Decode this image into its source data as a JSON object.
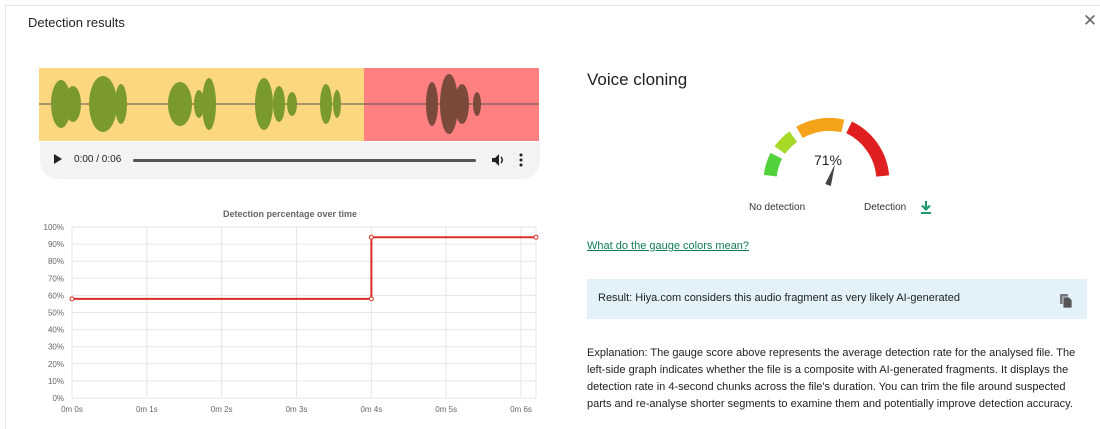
{
  "dialog": {
    "title": "Detection results",
    "close_icon": "close-icon"
  },
  "player": {
    "time": "0:00 / 0:06",
    "icons": [
      "play-icon",
      "volume-icon",
      "more-options-icon"
    ]
  },
  "waveform": {
    "colors": {
      "safe": "#fbd77f",
      "flagged": "#ff8080",
      "wave_safe": "#7a9a2f",
      "wave_flagged": "#7b4a3a"
    },
    "flagged_from_fraction": 0.65
  },
  "chart_data": {
    "type": "line",
    "title": "Detection percentage over time",
    "x": [
      0,
      4,
      4,
      6.2
    ],
    "y": [
      58,
      58,
      94,
      94
    ],
    "x_tick_labels": [
      "0m 0s",
      "0m 1s",
      "0m 2s",
      "0m 3s",
      "0m 4s",
      "0m 5s",
      "0m 6s"
    ],
    "y_tick_labels": [
      "0%",
      "10%",
      "20%",
      "30%",
      "40%",
      "50%",
      "60%",
      "70%",
      "80%",
      "90%",
      "100%"
    ],
    "xlim": [
      0,
      6.2
    ],
    "ylim": [
      0,
      100
    ],
    "grid": true,
    "color": "#d93025"
  },
  "detector": {
    "title": "Voice cloning",
    "score": 71,
    "score_label": "71%",
    "no_detection_label": "No detection",
    "detection_label": "Detection",
    "download_icon": "download-icon",
    "gauge_colors": [
      "#53d13a",
      "#a8d928",
      "#f5a318",
      "#e02020"
    ]
  },
  "help_link": "What do the gauge colors mean?",
  "result": {
    "text": "Result: Hiya.com considers this audio fragment as very likely AI-generated",
    "copy_icon": "copy-icon"
  },
  "explanation": "Explanation: The gauge score above represents the average detection rate for the analysed file. The left-side graph indicates whether the file is a composite with AI-generated fragments. It displays the detection rate in 4-second chunks across the file's duration. You can trim the file around suspected parts and re-analyse shorter segments to examine them and potentially improve detection accuracy."
}
